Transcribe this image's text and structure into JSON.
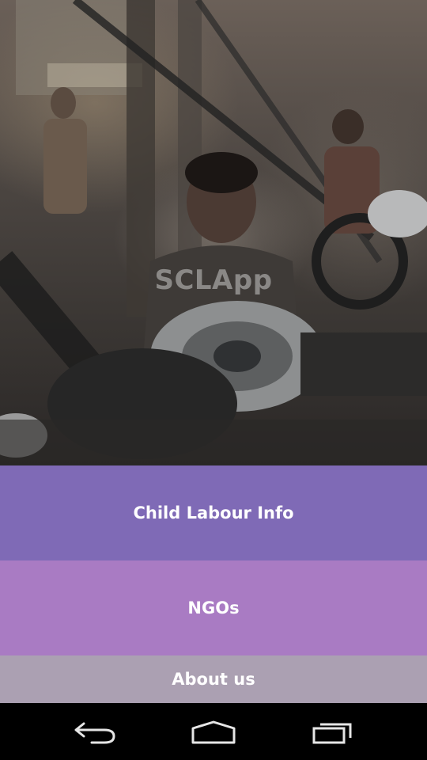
{
  "app": {
    "watermark_title": "SCLApp"
  },
  "hero": {
    "icon": "factory-photo"
  },
  "menu": {
    "items": [
      {
        "label": "Child Labour Info",
        "color": "#7f6ab6"
      },
      {
        "label": "NGOs",
        "color": "#a97bc3"
      },
      {
        "label": "About us",
        "color": "#aba0b2"
      }
    ]
  },
  "navbar": {
    "icons": [
      "back-icon",
      "home-icon",
      "recent-apps-icon"
    ]
  }
}
